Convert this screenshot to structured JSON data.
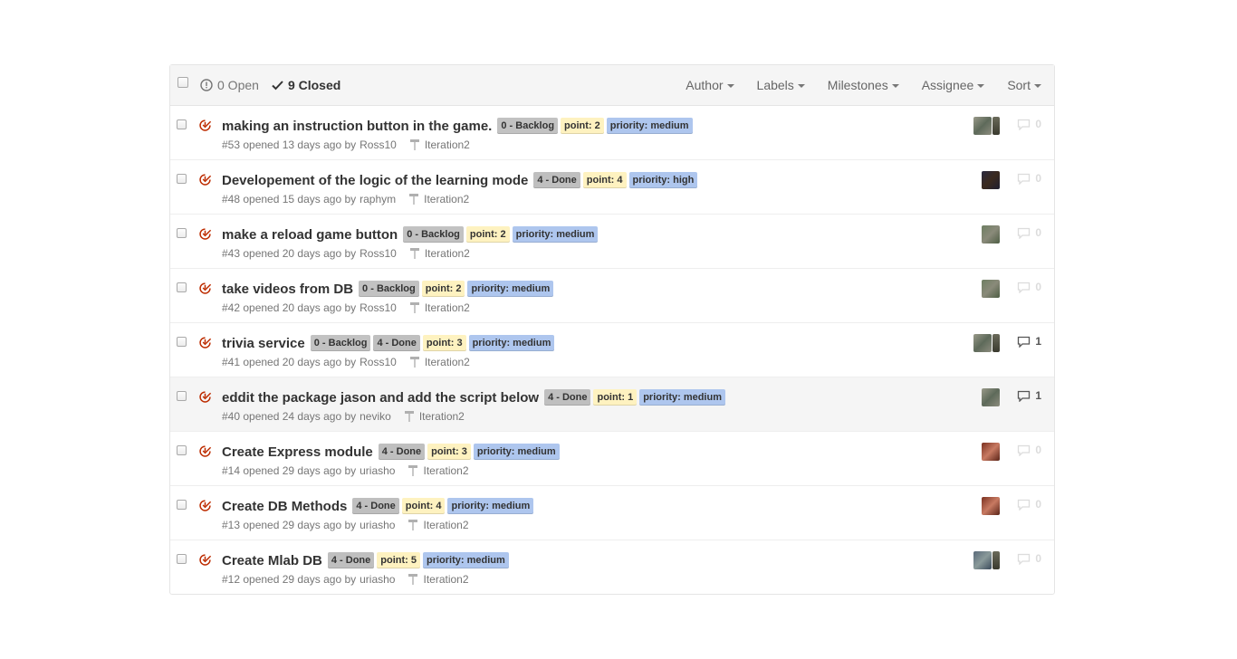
{
  "colors": {
    "closed_icon": "#bd2c00",
    "label_backlog": "#c2c2c2",
    "label_done": "#bfbfbf",
    "label_point": "#fef2c0",
    "label_priority": "#aec6ee"
  },
  "header": {
    "open_count_label": "0 Open",
    "closed_count_label": "9 Closed",
    "filters": {
      "author": "Author",
      "labels": "Labels",
      "milestones": "Milestones",
      "assignee": "Assignee",
      "sort": "Sort"
    }
  },
  "issues": [
    {
      "title": "making an instruction button in the game.",
      "labels": [
        {
          "text": "0 - Backlog",
          "kind": "backlog"
        },
        {
          "text": "point: 2",
          "kind": "point"
        },
        {
          "text": "priority: medium",
          "kind": "priority"
        }
      ],
      "meta_prefix": "#53 opened 13 days ago by",
      "author": "Ross10",
      "milestone": "Iteration2",
      "assignees": [
        "avatar-gray",
        "avatar-half"
      ],
      "comments": "0"
    },
    {
      "title": "Developement of the logic of the learning mode",
      "labels": [
        {
          "text": "4 - Done",
          "kind": "done"
        },
        {
          "text": "point: 4",
          "kind": "point"
        },
        {
          "text": "priority: high",
          "kind": "priority"
        }
      ],
      "meta_prefix": "#48 opened 15 days ago by",
      "author": "raphym",
      "milestone": "Iteration2",
      "assignees": [
        "avatar-dark"
      ],
      "comments": "0"
    },
    {
      "title": "make a reload game button",
      "labels": [
        {
          "text": "0 - Backlog",
          "kind": "backlog"
        },
        {
          "text": "point: 2",
          "kind": "point"
        },
        {
          "text": "priority: medium",
          "kind": "priority"
        }
      ],
      "meta_prefix": "#43 opened 20 days ago by",
      "author": "Ross10",
      "milestone": "Iteration2",
      "assignees": [
        "avatar-green"
      ],
      "comments": "0"
    },
    {
      "title": "take videos from DB",
      "labels": [
        {
          "text": "0 - Backlog",
          "kind": "backlog"
        },
        {
          "text": "point: 2",
          "kind": "point"
        },
        {
          "text": "priority: medium",
          "kind": "priority"
        }
      ],
      "meta_prefix": "#42 opened 20 days ago by",
      "author": "Ross10",
      "milestone": "Iteration2",
      "assignees": [
        "avatar-green"
      ],
      "comments": "0"
    },
    {
      "title": "trivia service",
      "labels": [
        {
          "text": "0 - Backlog",
          "kind": "backlog"
        },
        {
          "text": "4 - Done",
          "kind": "done"
        },
        {
          "text": "point: 3",
          "kind": "point"
        },
        {
          "text": "priority: medium",
          "kind": "priority"
        }
      ],
      "meta_prefix": "#41 opened 20 days ago by",
      "author": "Ross10",
      "milestone": "Iteration2",
      "assignees": [
        "avatar-gray",
        "avatar-half"
      ],
      "comments": "1"
    },
    {
      "title": "eddit the package jason and add the script below",
      "labels": [
        {
          "text": "4 - Done",
          "kind": "done"
        },
        {
          "text": "point: 1",
          "kind": "point"
        },
        {
          "text": "priority: medium",
          "kind": "priority"
        }
      ],
      "meta_prefix": "#40 opened 24 days ago by",
      "author": "neviko",
      "milestone": "Iteration2",
      "assignees": [
        "avatar-gray"
      ],
      "comments": "1"
    },
    {
      "title": "Create Express module",
      "labels": [
        {
          "text": "4 - Done",
          "kind": "done"
        },
        {
          "text": "point: 3",
          "kind": "point"
        },
        {
          "text": "priority: medium",
          "kind": "priority"
        }
      ],
      "meta_prefix": "#14 opened 29 days ago by",
      "author": "uriasho",
      "milestone": "Iteration2",
      "assignees": [
        "avatar-red"
      ],
      "comments": "0"
    },
    {
      "title": "Create DB Methods",
      "labels": [
        {
          "text": "4 - Done",
          "kind": "done"
        },
        {
          "text": "point: 4",
          "kind": "point"
        },
        {
          "text": "priority: medium",
          "kind": "priority"
        }
      ],
      "meta_prefix": "#13 opened 29 days ago by",
      "author": "uriasho",
      "milestone": "Iteration2",
      "assignees": [
        "avatar-red"
      ],
      "comments": "0"
    },
    {
      "title": "Create Mlab DB",
      "labels": [
        {
          "text": "4 - Done",
          "kind": "done"
        },
        {
          "text": "point: 5",
          "kind": "point"
        },
        {
          "text": "priority: medium",
          "kind": "priority"
        }
      ],
      "meta_prefix": "#12 opened 29 days ago by",
      "author": "uriasho",
      "milestone": "Iteration2",
      "assignees": [
        "avatar-blue",
        "avatar-half"
      ],
      "comments": "0"
    }
  ]
}
